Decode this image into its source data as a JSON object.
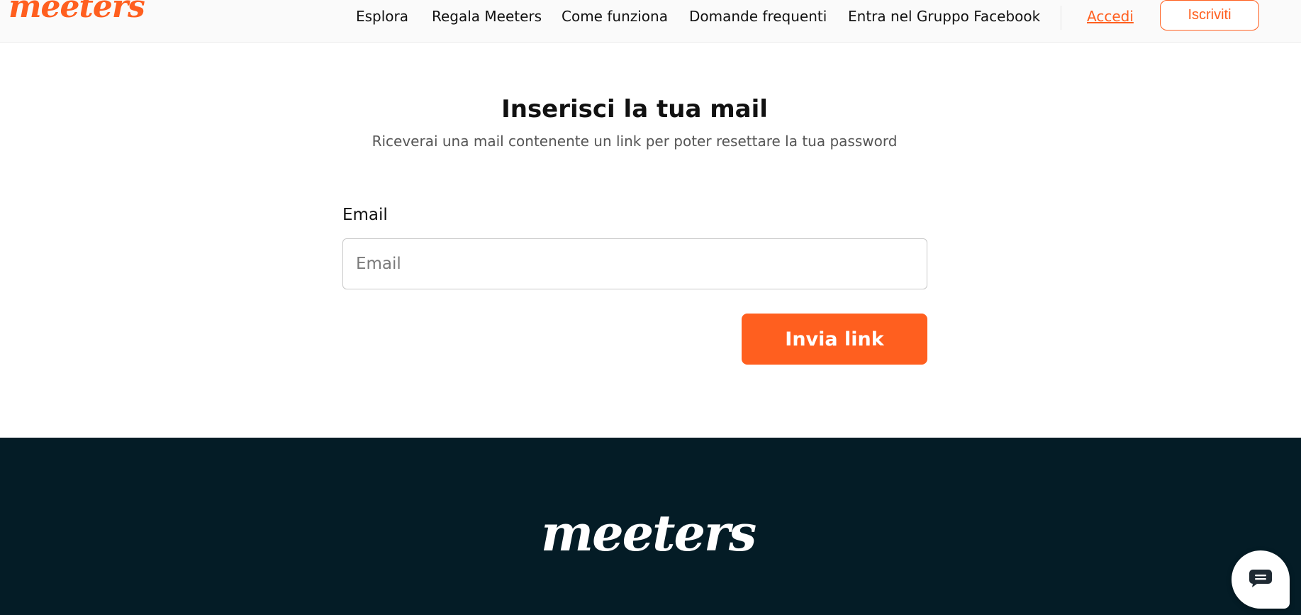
{
  "brand": {
    "logo": "meeters",
    "accent_color": "#ff5f1f",
    "footer_bg": "#041c26"
  },
  "header": {
    "nav": [
      {
        "label": "Esplora"
      },
      {
        "label": "Regala Meeters"
      },
      {
        "label": "Come funziona"
      },
      {
        "label": "Domande frequenti"
      },
      {
        "label": "Entra nel Gruppo Facebook"
      }
    ],
    "login_label": "Accedi",
    "signup_label": "Iscriviti"
  },
  "main": {
    "title": "Inserisci la tua mail",
    "subtitle": "Riceverai una mail contenente un link per poter resettare la tua password",
    "email_label": "Email",
    "email_placeholder": "Email",
    "email_value": "",
    "submit_label": "Invia link"
  },
  "footer": {
    "logo": "meeters"
  },
  "chat": {
    "icon": "chat-bubble-icon"
  }
}
